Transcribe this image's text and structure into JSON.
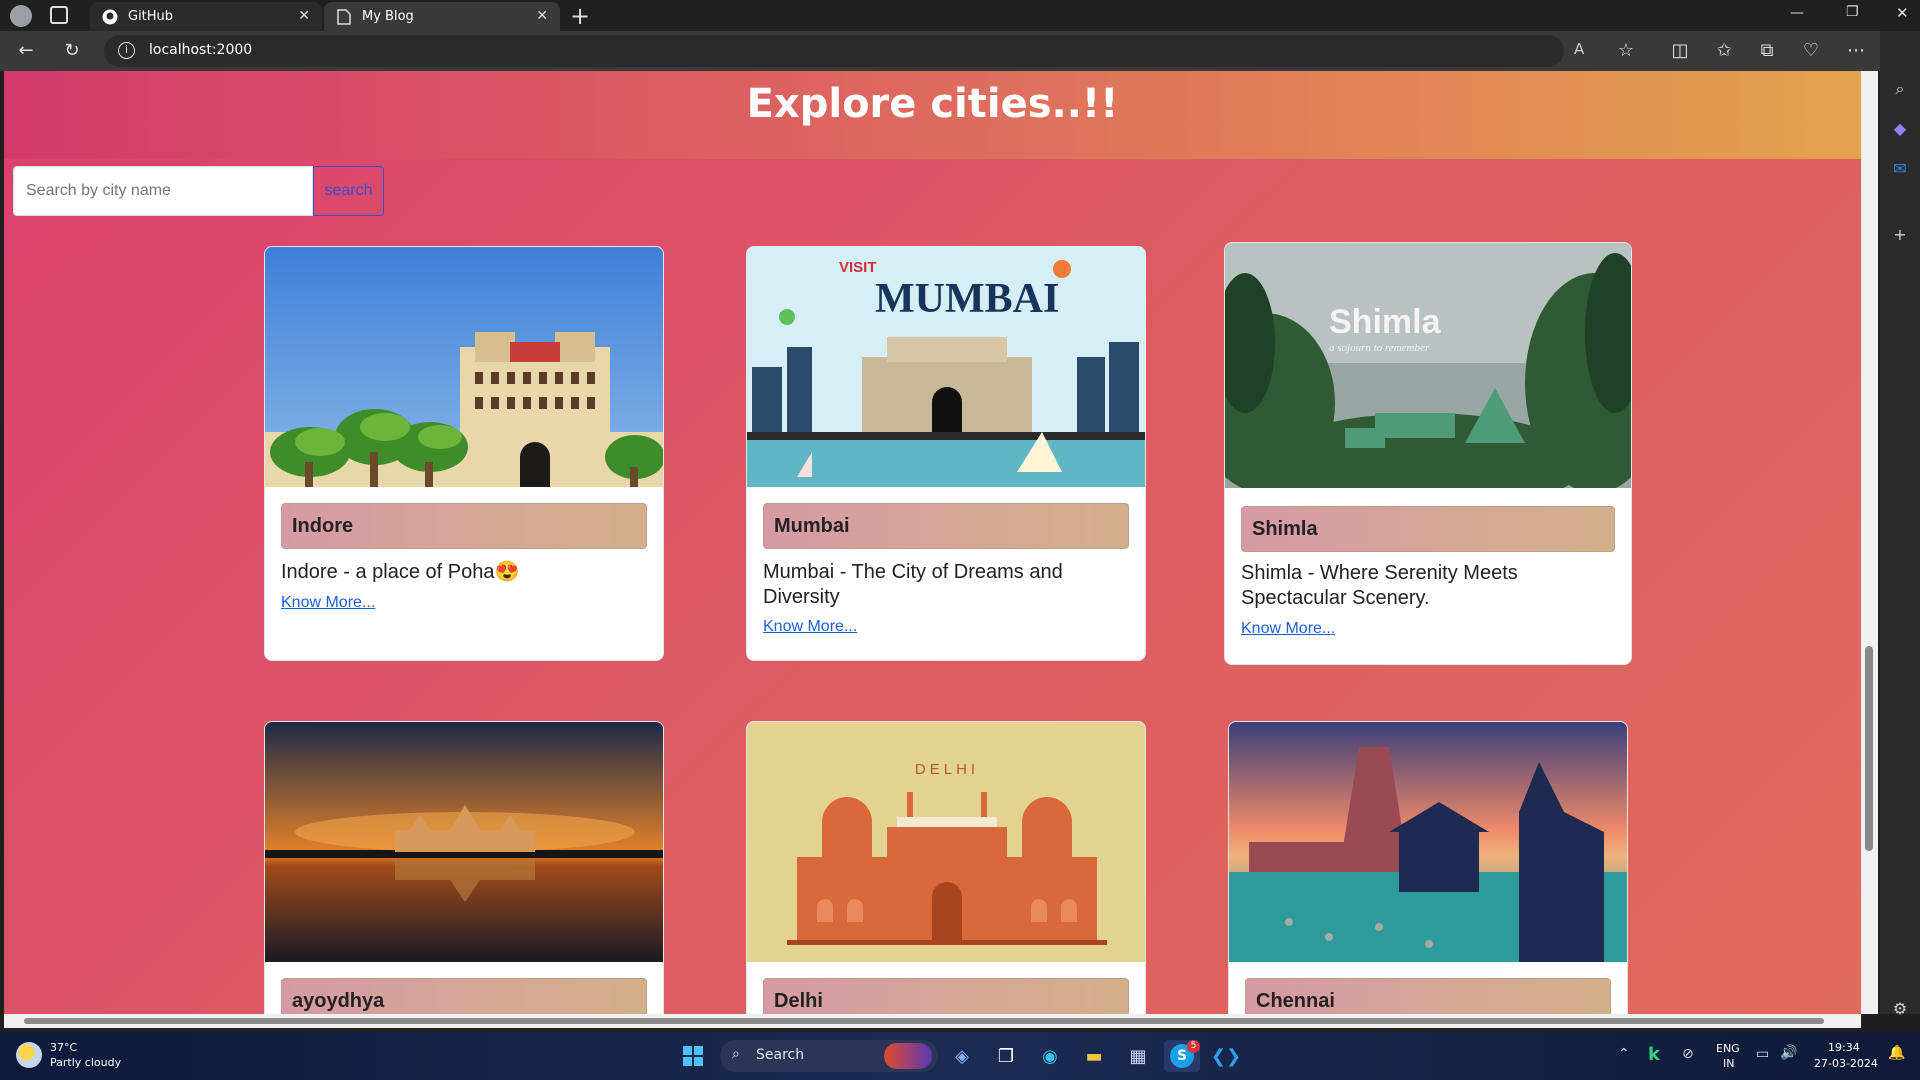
{
  "browser": {
    "tabs": [
      {
        "title": "GitHub",
        "icon": "github-icon"
      },
      {
        "title": "My Blog",
        "icon": "page-icon"
      }
    ],
    "url": "localhost:2000"
  },
  "page": {
    "heading": "Explore cities..!!",
    "search": {
      "placeholder": "Search by city name",
      "button_label": "search"
    },
    "cards": [
      {
        "name": "Indore",
        "description": "Indore - a place of Poha😍",
        "link": "Know More...",
        "image": "Indore palace illustration"
      },
      {
        "name": "Mumbai",
        "description": "Mumbai - The City of Dreams and Diversity",
        "link": "Know More...",
        "image": "Gateway of India illustration",
        "image_text": {
          "visit": "VISIT",
          "city": "MUMBAI"
        }
      },
      {
        "name": "Shimla",
        "description": "Shimla - Where Serenity Meets Spectacular Scenery.",
        "link": "Know More...",
        "image": "Shimla hills photo",
        "image_text": {
          "city": "Shimla",
          "tagline": "a sojourn to remember"
        }
      },
      {
        "name": "ayoydhya",
        "description": "",
        "link": "",
        "image": "temple at sunset photo"
      },
      {
        "name": "Delhi",
        "description": "",
        "link": "",
        "image": "Red Fort illustration",
        "image_text": {
          "city": "DELHI"
        }
      },
      {
        "name": "Chennai",
        "description": "",
        "link": "",
        "image": "temple illustration"
      }
    ]
  },
  "taskbar": {
    "weather": {
      "temp": "37°C",
      "condition": "Partly cloudy"
    },
    "search_label": "Search",
    "language": {
      "line1": "ENG",
      "line2": "IN"
    },
    "time": "19:34",
    "date": "27-03-2024",
    "skype_badge": "5"
  },
  "colors": {
    "accent": "#3a4fd8",
    "link": "#1a5fd8"
  }
}
